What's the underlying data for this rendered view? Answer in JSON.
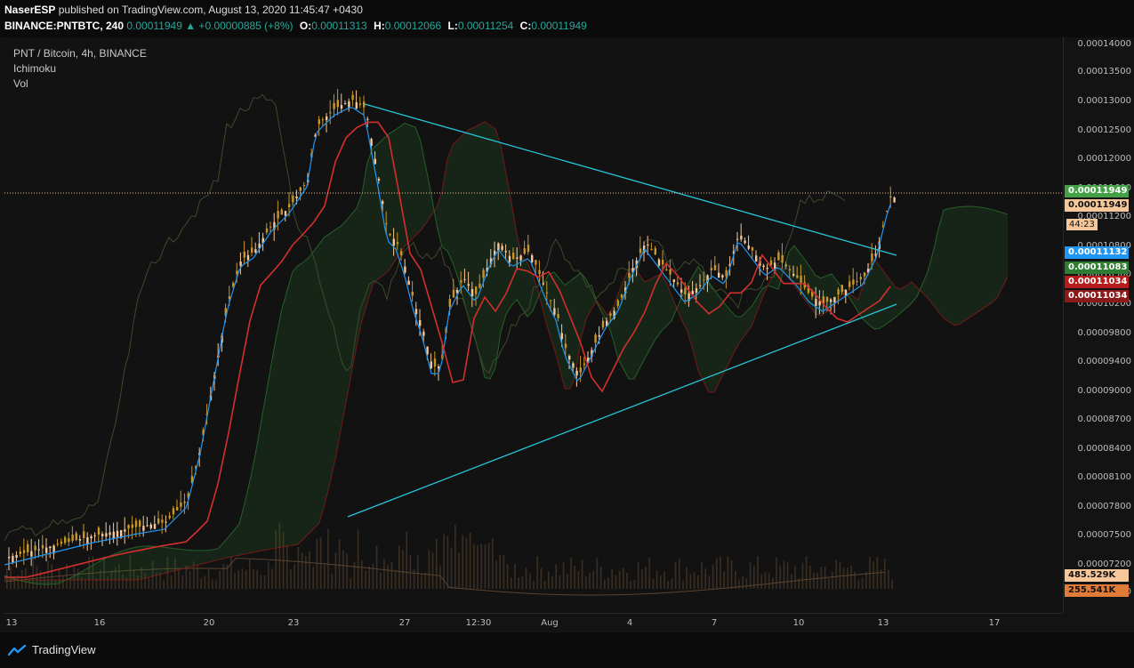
{
  "header": {
    "author": "NaserESP",
    "published_text": "published on TradingView.com, August 13, 2020 11:45:47 +0430",
    "symbol_line": "BINANCE:PNTBTC, 240",
    "last": "0.00011949",
    "change": "▲ +0.00000885 (+8%)",
    "o_label": "O:",
    "o_value": "0.00011313",
    "h_label": "H:",
    "h_value": "0.00012066",
    "l_label": "L:",
    "l_value": "0.00011254",
    "c_label": "C:",
    "c_value": "0.00011949"
  },
  "legend": {
    "title": "PNT / Bitcoin, 4h, BINANCE",
    "indicator1": "Ichimoku",
    "indicator2": "Vol"
  },
  "y_axis": {
    "ticks": [
      "0.00014000",
      "0.00013500",
      "0.00013000",
      "0.00012500",
      "0.00012000",
      "0.00011600",
      "0.00011200",
      "0.00010800",
      "0.00010500",
      "0.00010200",
      "0.00009800",
      "0.00009400",
      "0.00009000",
      "0.00008700",
      "0.00008400",
      "0.00008100",
      "0.00007800",
      "0.00007500",
      "0.00007200",
      "0.00006920"
    ]
  },
  "price_labels": [
    {
      "text": "0.00011949",
      "bg": "#43a047",
      "fg": "#ffffff"
    },
    {
      "text": "0.00011949",
      "bg": "#f6c79a",
      "fg": "#111111"
    },
    {
      "text": "0.00011132",
      "bg": "#2196f3",
      "fg": "#ffffff"
    },
    {
      "text": "0.00011083",
      "bg": "#2e7d32",
      "fg": "#ffffff"
    },
    {
      "text": "0.00011034",
      "bg": "#b71c1c",
      "fg": "#ffffff"
    },
    {
      "text": "0.00011034",
      "bg": "#8b1a1a",
      "fg": "#ffffff"
    },
    {
      "text": "485.529K",
      "bg": "#f6c79a",
      "fg": "#111111"
    },
    {
      "text": "255.541K",
      "bg": "#e07b39",
      "fg": "#111111"
    }
  ],
  "timer": "44:23",
  "x_axis": {
    "ticks": [
      "13",
      "16",
      "20",
      "23",
      "27",
      "12:30",
      "Aug",
      "4",
      "7",
      "10",
      "13",
      "17"
    ]
  },
  "footer": {
    "brand": "TradingView"
  },
  "colors": {
    "background": "#131313",
    "candle_up": "#f6c79a",
    "candle_down": "#c8962a",
    "tenkan": "#2196f3",
    "kijun": "#d32f2f",
    "trendline": "#26c6da",
    "cloud_bull": "#2e7d32",
    "cloud_bear": "#8b1a1a"
  },
  "chart_data": {
    "type": "candlestick",
    "symbol": "PNT / Bitcoin",
    "ylim": [
      6.92e-05,
      0.000141
    ],
    "last_price": 0.00011949
  }
}
